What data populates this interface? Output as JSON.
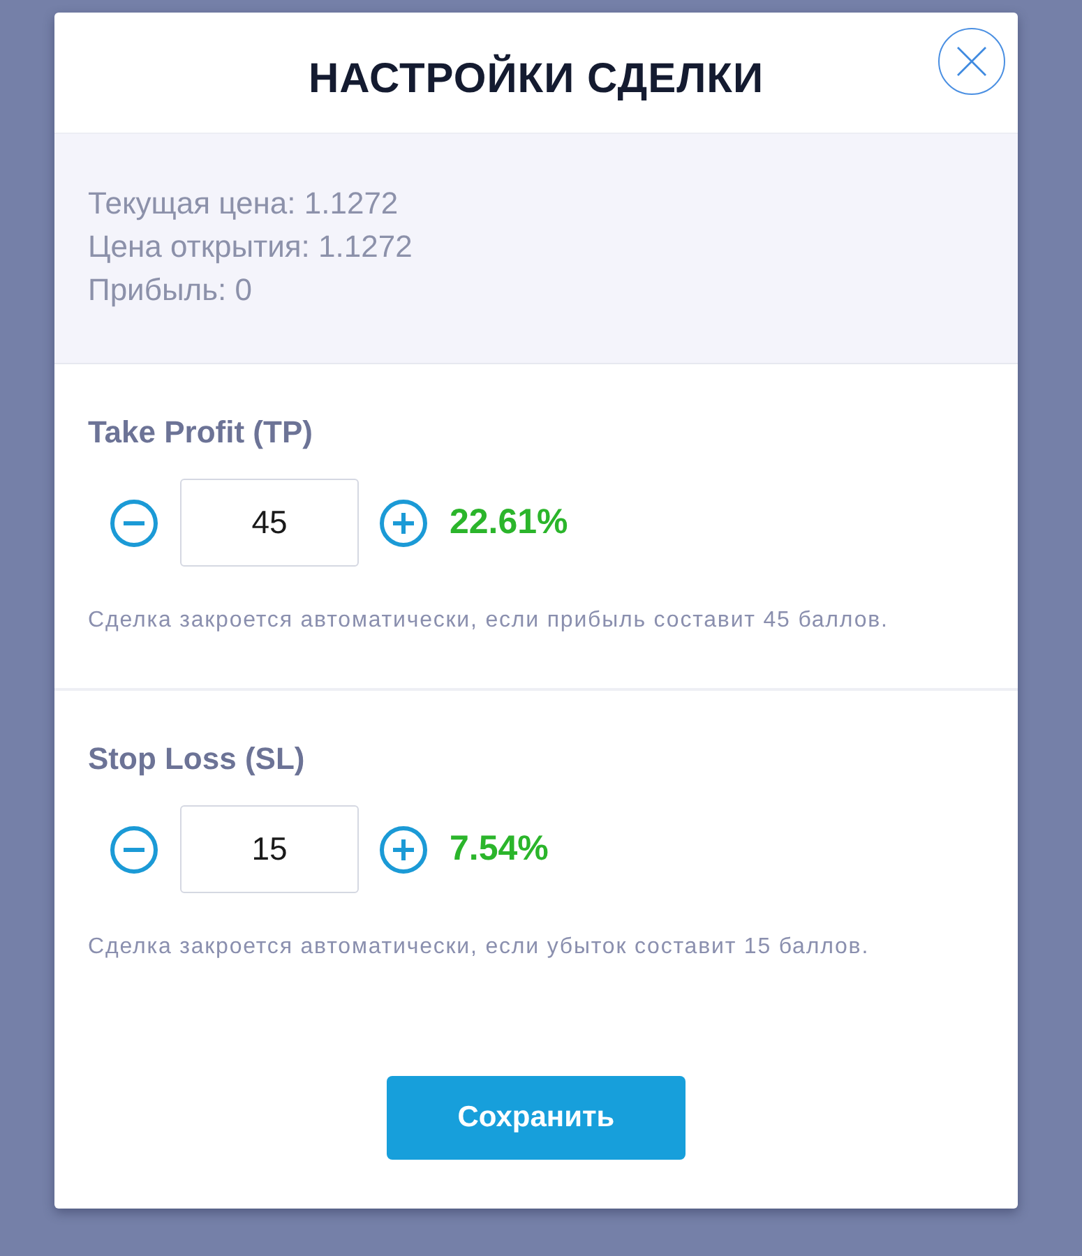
{
  "dialog": {
    "title": "НАСТРОЙКИ СДЕЛКИ"
  },
  "info": [
    "Текущая цена: 1.1272",
    "Цена открытия: 1.1272",
    "Прибыль: 0"
  ],
  "settings": [
    {
      "label": "Take Profit (TP)",
      "value": "45",
      "percent": "22.61%",
      "note": "Сделка закроется автоматически, если прибыль составит 45 баллов."
    },
    {
      "label": "Stop Loss (SL)",
      "value": "15",
      "percent": "7.54%",
      "note": "Сделка закроется автоматически, если убыток составит 15 баллов."
    }
  ],
  "save_button": "Сохранить"
}
